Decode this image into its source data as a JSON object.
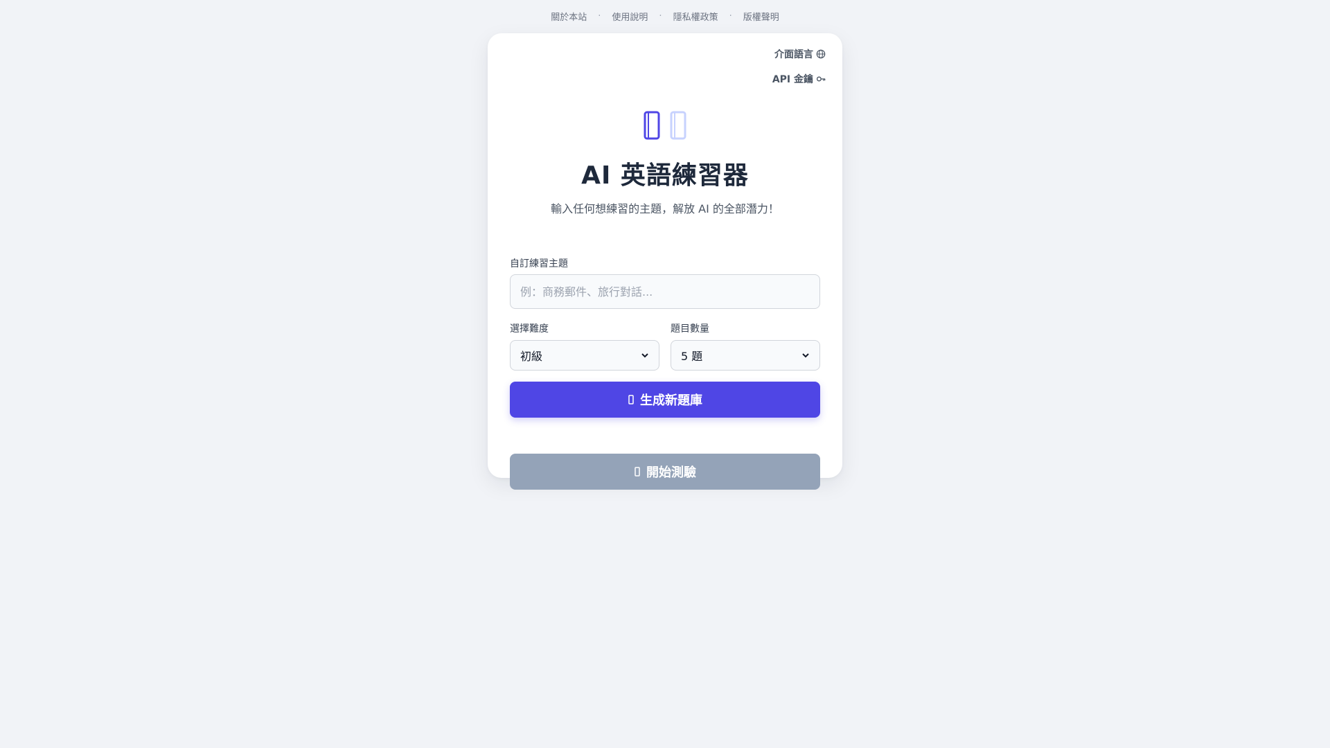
{
  "top_nav": {
    "links": [
      "關於本站",
      "使用說明",
      "隱私權政策",
      "版權聲明"
    ],
    "separator": "·"
  },
  "card": {
    "language_link": "介面語言",
    "api_key_link": "API 金鑰",
    "title": "AI 英語練習器",
    "subtitle": "輸入任何想練習的主題，解放 AI 的全部潛力！",
    "topic": {
      "label": "自訂練習主題",
      "value": "",
      "placeholder": "例：商務郵件、旅行對話..."
    },
    "difficulty": {
      "label": "選擇難度",
      "selected": "初級"
    },
    "question_count": {
      "label": "題目數量",
      "selected": "5 題"
    },
    "generate_button": "生成新題庫",
    "start_button": "開始測驗"
  },
  "colors": {
    "primary": "#4f46e5",
    "disabled": "#94a3b8",
    "background": "#f1f3f7",
    "card": "#ffffff"
  },
  "icons": {
    "language": "globe-icon",
    "api_key": "key-icon",
    "hero_primary": "book-icon",
    "hero_secondary": "sparkle-icon",
    "generate": "magic-wand-icon",
    "start": "play-icon"
  }
}
